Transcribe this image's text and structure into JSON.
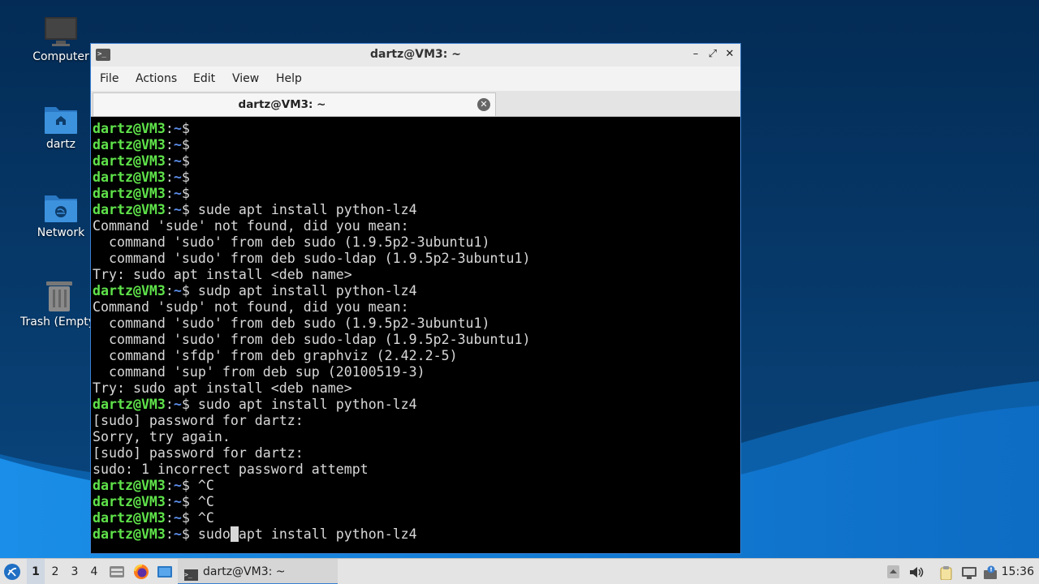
{
  "desktop": {
    "icons": [
      {
        "label": "Computer",
        "icon": "monitor-icon"
      },
      {
        "label": "dartz",
        "icon": "home-folder-icon"
      },
      {
        "label": "Network",
        "icon": "network-folder-icon"
      },
      {
        "label": "Trash (Empty)",
        "icon": "trash-icon"
      }
    ]
  },
  "window": {
    "title": "dartz@VM3: ~",
    "menu": [
      "File",
      "Actions",
      "Edit",
      "View",
      "Help"
    ],
    "tab_label": "dartz@VM3: ~",
    "controls": {
      "minimize": "–",
      "maximize": "⤢",
      "close": "✕"
    }
  },
  "terminal": {
    "prompt_user": "dartz@VM3",
    "prompt_tail": ":",
    "prompt_path": "~",
    "prompt_sign": "$",
    "lines": [
      {
        "p": true,
        "t": ""
      },
      {
        "p": true,
        "t": ""
      },
      {
        "p": true,
        "t": ""
      },
      {
        "p": true,
        "t": ""
      },
      {
        "p": true,
        "t": ""
      },
      {
        "p": true,
        "t": " sude apt install python-lz4"
      },
      {
        "p": false,
        "t": "Command 'sude' not found, did you mean:"
      },
      {
        "p": false,
        "t": "  command 'sudo' from deb sudo (1.9.5p2-3ubuntu1)"
      },
      {
        "p": false,
        "t": "  command 'sudo' from deb sudo-ldap (1.9.5p2-3ubuntu1)"
      },
      {
        "p": false,
        "t": "Try: sudo apt install <deb name>"
      },
      {
        "p": true,
        "t": " sudp apt install python-lz4"
      },
      {
        "p": false,
        "t": "Command 'sudp' not found, did you mean:"
      },
      {
        "p": false,
        "t": "  command 'sudo' from deb sudo (1.9.5p2-3ubuntu1)"
      },
      {
        "p": false,
        "t": "  command 'sudo' from deb sudo-ldap (1.9.5p2-3ubuntu1)"
      },
      {
        "p": false,
        "t": "  command 'sfdp' from deb graphviz (2.42.2-5)"
      },
      {
        "p": false,
        "t": "  command 'sup' from deb sup (20100519-3)"
      },
      {
        "p": false,
        "t": "Try: sudo apt install <deb name>"
      },
      {
        "p": true,
        "t": " sudo apt install python-lz4"
      },
      {
        "p": false,
        "t": "[sudo] password for dartz:"
      },
      {
        "p": false,
        "t": "Sorry, try again."
      },
      {
        "p": false,
        "t": "[sudo] password for dartz:"
      },
      {
        "p": false,
        "t": "sudo: 1 incorrect password attempt"
      },
      {
        "p": true,
        "t": " ^C"
      },
      {
        "p": true,
        "t": " ^C"
      },
      {
        "p": true,
        "t": " ^C"
      }
    ],
    "current_before_cursor": " sudo",
    "current_cursor_char": " ",
    "current_after_cursor": "apt install python-lz4"
  },
  "taskbar": {
    "workspaces": [
      "1",
      "2",
      "3",
      "4"
    ],
    "active_workspace": "1",
    "launchers": [
      "file-manager-icon",
      "firefox-icon",
      "show-desktop-icon"
    ],
    "task_label": "dartz@VM3: ~",
    "tray": [
      "tray-arrow-icon",
      "volume-icon",
      "clipboard-icon",
      "network-icon",
      "notification-icon"
    ],
    "clock": "15:36"
  },
  "colors": {
    "accent": "#3a7fd0",
    "prompt_green": "#5fe34a",
    "prompt_blue": "#5b8de8",
    "terminal_bg": "#000000",
    "desktop_blue": "#07386a"
  }
}
